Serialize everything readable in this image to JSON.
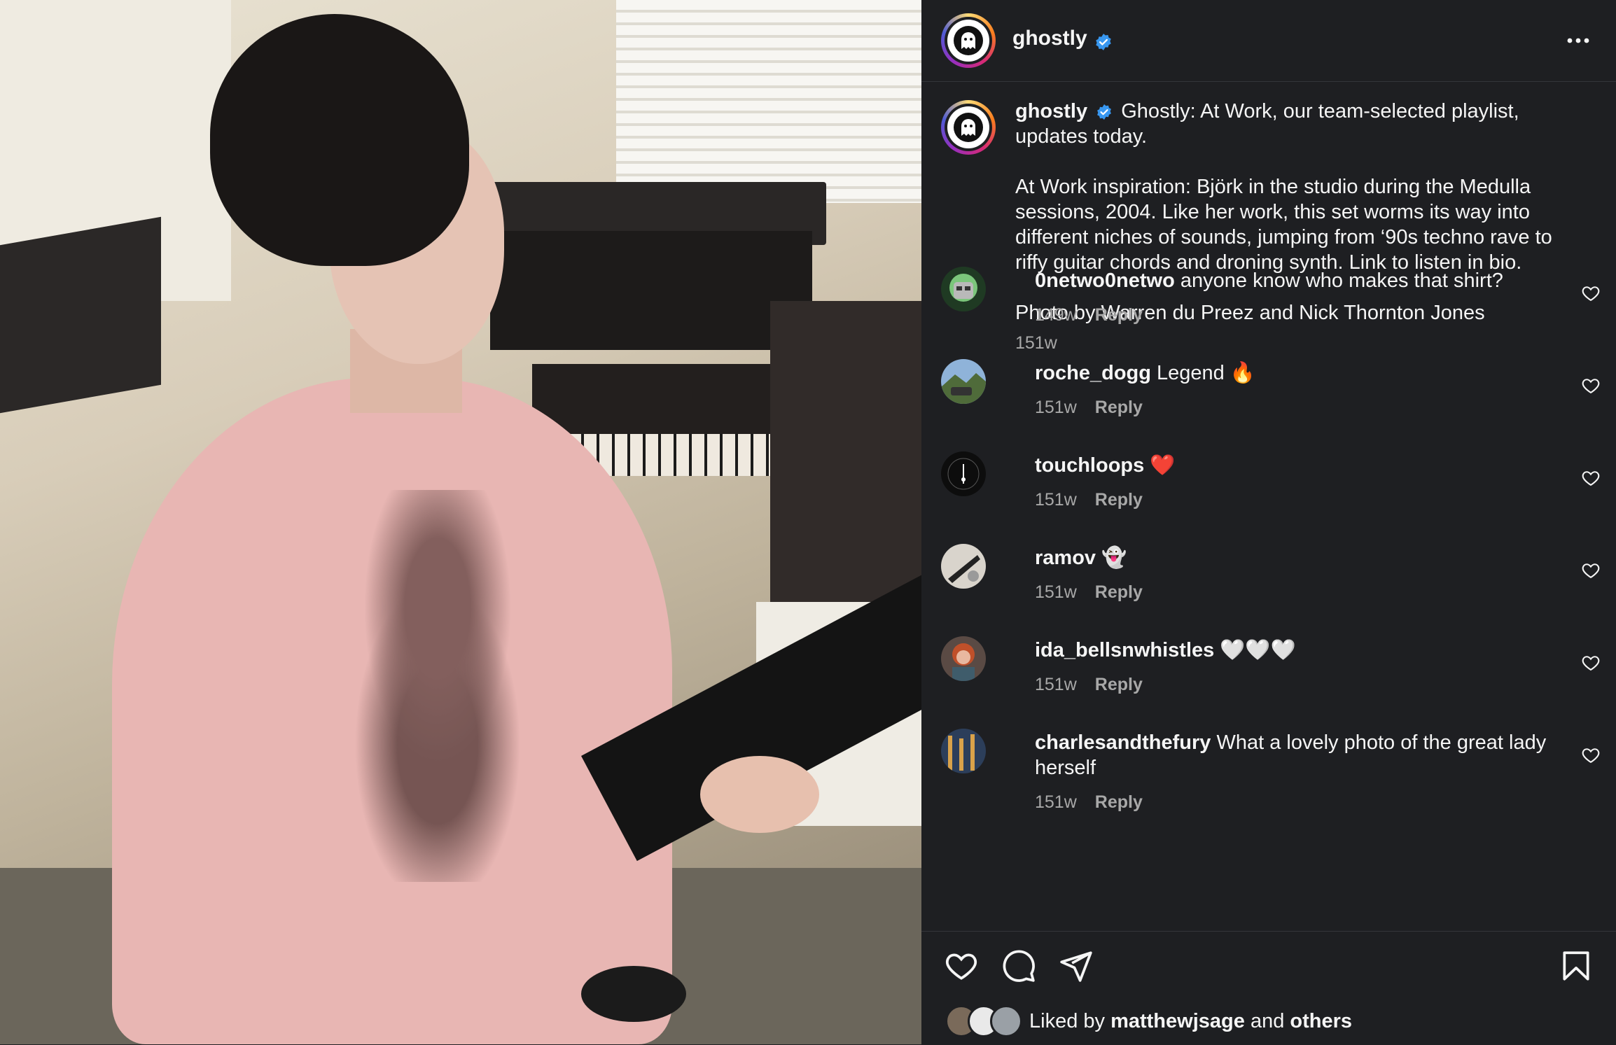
{
  "post": {
    "username": "ghostly",
    "caption_title": "Ghostly: At Work, our team-selected playlist, updates today.",
    "caption_paragraph": "At Work inspiration: Björk in the studio during the Medulla sessions, 2004. Like her work, this set worms its way into different niches of sounds, jumping from ‘90s techno rave to riffy guitar chords and droning synth. Link to listen in bio.",
    "caption_credit": "Photo by Warren du Preez and Nick Thornton Jones",
    "caption_time": "151w"
  },
  "comments": [
    {
      "user": "0netwo0netwo",
      "text": "anyone know who makes that shirt?",
      "time": "149w",
      "reply": "Reply"
    },
    {
      "user": "roche_dogg",
      "text": "Legend 🔥",
      "time": "151w",
      "reply": "Reply"
    },
    {
      "user": "touchloops",
      "text": "❤️",
      "time": "151w",
      "reply": "Reply"
    },
    {
      "user": "ramov",
      "text": "👻",
      "time": "151w",
      "reply": "Reply"
    },
    {
      "user": "ida_bellsnwhistles",
      "text": "🤍🤍🤍",
      "time": "151w",
      "reply": "Reply"
    },
    {
      "user": "charlesandthefury",
      "text": "What a lovely photo of the great lady herself",
      "time": "151w",
      "reply": "Reply"
    }
  ],
  "likes": {
    "prefix": "Liked by",
    "user": "matthewjsage",
    "conj": "and",
    "others": "others"
  },
  "icons": {
    "more": "more-horizontal-icon",
    "verified": "verified-badge-icon",
    "heart": "heart-icon",
    "comment": "comment-icon",
    "share": "share-icon",
    "save": "bookmark-icon"
  },
  "colors": {
    "background": "#1e1f22",
    "text": "#f5f5f5",
    "muted": "#a8a8a8",
    "verified": "#3897f0"
  }
}
